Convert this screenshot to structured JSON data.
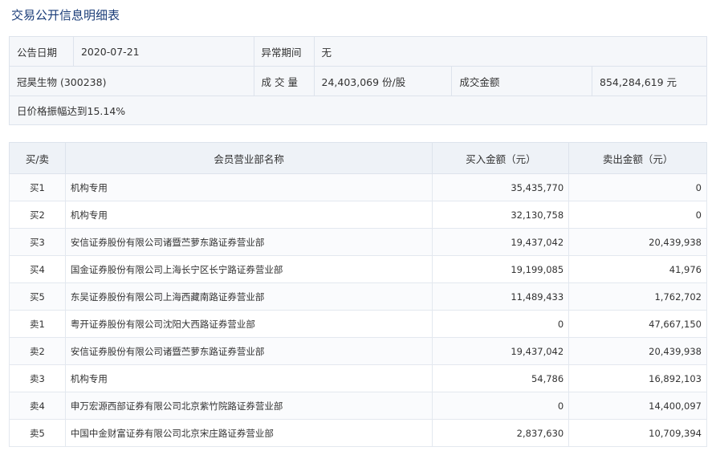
{
  "page": {
    "title": "交易公开信息明细表"
  },
  "info": {
    "announce_date_label": "公告日期",
    "announce_date": "2020-07-21",
    "abnormal_period_label": "异常期间",
    "abnormal_period": "无",
    "stock": "冠昊生物 (300238)",
    "volume_label": "成 交 量",
    "volume": "24,403,069 份/股",
    "amount_label": "成交金额",
    "amount": "854,284,619 元",
    "reason": "日价格振幅达到15.14%"
  },
  "table": {
    "headers": [
      "买/卖",
      "会员营业部名称",
      "买入金额（元）",
      "卖出金额（元）"
    ],
    "rows": [
      {
        "side": "买1",
        "name": "机构专用",
        "buy": "35,435,770",
        "sell": "0"
      },
      {
        "side": "买2",
        "name": "机构专用",
        "buy": "32,130,758",
        "sell": "0"
      },
      {
        "side": "买3",
        "name": "安信证券股份有限公司诸暨苎萝东路证券营业部",
        "buy": "19,437,042",
        "sell": "20,439,938"
      },
      {
        "side": "买4",
        "name": "国金证券股份有限公司上海长宁区长宁路证券营业部",
        "buy": "19,199,085",
        "sell": "41,976"
      },
      {
        "side": "买5",
        "name": "东吴证券股份有限公司上海西藏南路证券营业部",
        "buy": "11,489,433",
        "sell": "1,762,702"
      },
      {
        "side": "卖1",
        "name": "粤开证券股份有限公司沈阳大西路证券营业部",
        "buy": "0",
        "sell": "47,667,150"
      },
      {
        "side": "卖2",
        "name": "安信证券股份有限公司诸暨苎萝东路证券营业部",
        "buy": "19,437,042",
        "sell": "20,439,938"
      },
      {
        "side": "卖3",
        "name": "机构专用",
        "buy": "54,786",
        "sell": "16,892,103"
      },
      {
        "side": "卖4",
        "name": "申万宏源西部证券有限公司北京紫竹院路证券营业部",
        "buy": "0",
        "sell": "14,400,097"
      },
      {
        "side": "卖5",
        "name": "中国中金财富证券有限公司北京宋庄路证券营业部",
        "buy": "2,837,630",
        "sell": "10,709,394"
      }
    ]
  }
}
